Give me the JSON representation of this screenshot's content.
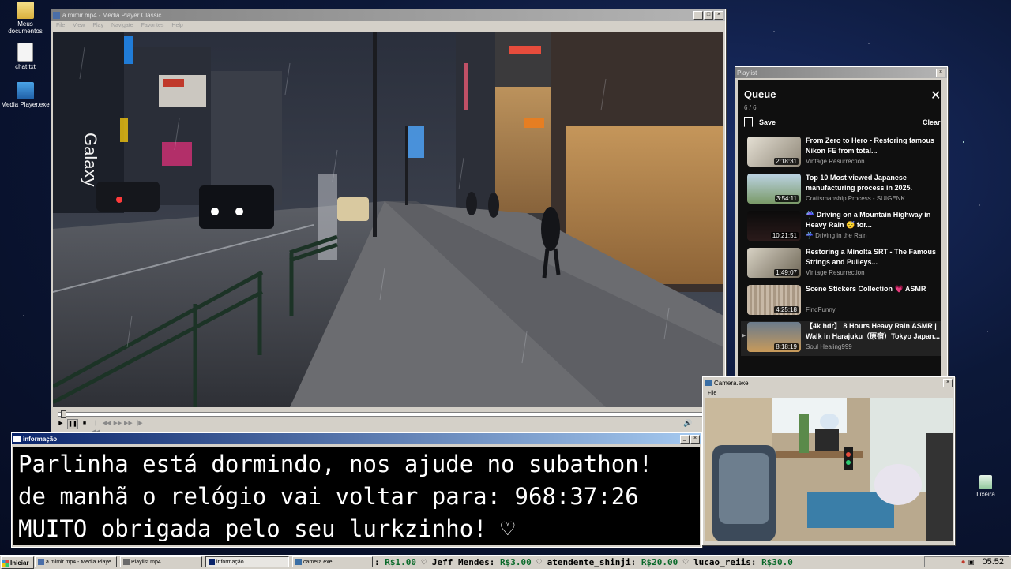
{
  "desktop": {
    "icons": [
      {
        "label": "Meus documentos",
        "icon": "folder-icon"
      },
      {
        "label": "chat.txt",
        "icon": "text-file-icon"
      },
      {
        "label": "Media Player.exe",
        "icon": "media-player-icon"
      },
      {
        "label": "Lixeira",
        "icon": "recycle-bin-icon"
      }
    ]
  },
  "player": {
    "title": "a mimir.mp4 - Media Player Classic",
    "menu": [
      "File",
      "View",
      "Play",
      "Navigate",
      "Favorites",
      "Help"
    ],
    "progress": 0.005,
    "video_signs": {
      "galaxy": "Galaxy"
    }
  },
  "playlist": {
    "window_title": "Playlist",
    "heading": "Queue",
    "count": "6 / 6",
    "save": "Save",
    "clear": "Clear",
    "items": [
      {
        "title": "From Zero to Hero - Restoring famous Nikon FE from total...",
        "channel": "Vintage Resurrection",
        "duration": "2:18:31"
      },
      {
        "title": "Top 10 Most viewed Japanese manufacturing process in 2025.",
        "channel": "Craftsmanship Process - SUIGENK...",
        "duration": "3:54:11"
      },
      {
        "title": "☔ Driving on a Mountain Highway in Heavy Rain 😴 for...",
        "channel": "☔ Driving in the Rain",
        "duration": "10:21:51"
      },
      {
        "title": "Restoring a Minolta SRT - The Famous Strings and Pulleys...",
        "channel": "Vintage Resurrection",
        "duration": "1:49:07"
      },
      {
        "title": "Scene Stickers Collection 💗 ASMR",
        "channel": "FindFunny",
        "duration": "4:25:18"
      },
      {
        "title": "【4k hdr】 8 Hours Heavy Rain ASMR | Walk in Harajuku（原宿）Tokyo Japan...",
        "channel": "Soul Healing999",
        "duration": "8:18:19"
      }
    ]
  },
  "info": {
    "title": "informação",
    "lines": [
      "Parlinha está dormindo, nos ajude no subathon!",
      "de manhã o relógio vai voltar para:  968:37:26",
      "MUITO obrigada pelo seu lurkzinho! ♡"
    ]
  },
  "camera": {
    "title": "Camera.exe",
    "menu": "File"
  },
  "taskbar": {
    "start": "Iniciar",
    "tasks": [
      "a mimir.mp4 - Media Playe...",
      "Playlist.mp4",
      "informação",
      "camera.exe"
    ],
    "ticker": [
      {
        "name": "",
        "amount": "R$1.00"
      },
      {
        "name": "Jeff Mendes:",
        "amount": "R$3.00"
      },
      {
        "name": "atendente_shinji:",
        "amount": "R$20.00"
      },
      {
        "name": "lucao_reiis:",
        "amount": "R$30.0"
      }
    ],
    "clock": "05:52"
  }
}
